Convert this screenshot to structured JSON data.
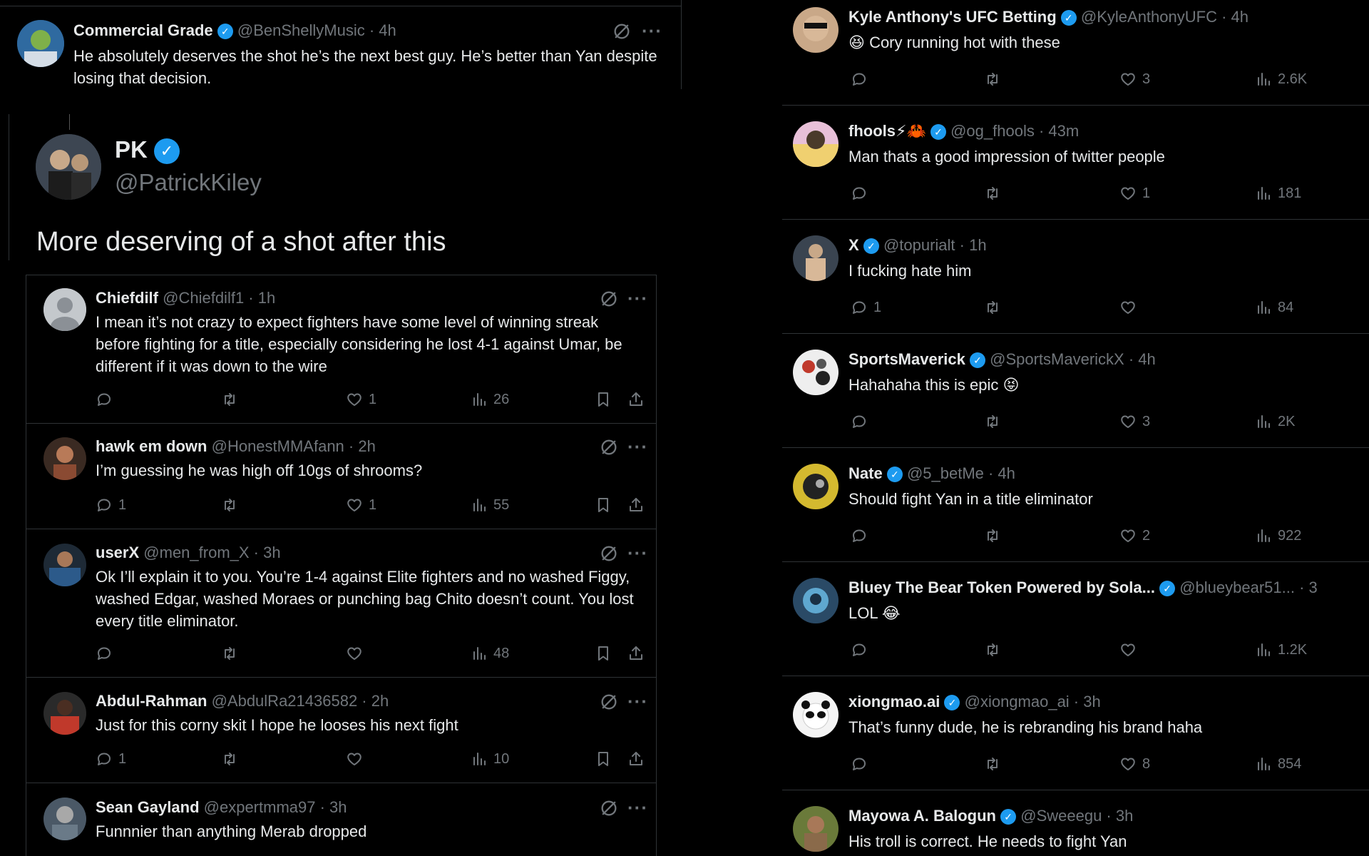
{
  "top_tweet": {
    "name": "Commercial Grade",
    "meta": "@BenShellyMusic · 4h",
    "text": "He absolutely deserves the shot he’s the next best guy. He’s better than Yan despite losing that decision."
  },
  "quoted": {
    "name": "PK",
    "handle": "@PatrickKiley",
    "text": "More deserving of a shot after this"
  },
  "left_replies": [
    {
      "name": "Chiefdilf",
      "meta": "@Chiefdilf1 · 1h",
      "text": "I mean it’s not crazy to expect fighters have some level of winning streak before fighting for a title, especially considering he lost 4-1 against Umar, be different if it was down to the wire",
      "replies": "",
      "likes": "1",
      "views": "26",
      "avatar": "#7b8186"
    },
    {
      "name": "hawk em down",
      "meta": "@HonestMMAfann · 2h",
      "text": "I’m guessing he was high off 10gs of shrooms?",
      "replies": "1",
      "likes": "1",
      "views": "55",
      "avatar": "#6b3a2a"
    },
    {
      "name": "userX",
      "meta": "@men_from_X · 3h",
      "text": "Ok I’ll explain it to you. You’re 1-4 against Elite fighters and no washed Figgy, washed Edgar, washed Moraes or punching bag Chito doesn’t count. You lost every title eliminator.",
      "replies": "",
      "likes": "",
      "views": "48",
      "avatar": "#2c5a8a"
    },
    {
      "name": "Abdul-Rahman",
      "meta": "@AbdulRa21436582 · 2h",
      "text": "Just for this corny skit I hope he looses his next fight",
      "replies": "1",
      "likes": "",
      "views": "10",
      "avatar": "#c0392b"
    },
    {
      "name": "Sean Gayland",
      "meta": "@expertmma97 · 3h",
      "text": "Funnnier than anything Merab dropped",
      "avatar": "#5a6b7a"
    }
  ],
  "right_replies": [
    {
      "name": "Kyle Anthony's UFC Betting",
      "meta": "@KyleAnthonyUFC · 4h",
      "text": "Cory running hot with these",
      "emoji": "😆",
      "replies": "",
      "likes": "3",
      "views": "2.6K",
      "avatar": "#b08a6a"
    },
    {
      "name": "fhools",
      "name_emoji": "⚡🦀",
      "meta": "@og_fhools · 43m",
      "text": "Man thats a good impression of twitter people",
      "replies": "",
      "likes": "1",
      "views": "181",
      "avatar": "#c7a0d8"
    },
    {
      "name": "X",
      "meta": "@topurialt · 1h",
      "text": "I fucking hate him",
      "replies": "1",
      "likes": "",
      "views": "84",
      "avatar": "#5d6d7a"
    },
    {
      "name": "SportsMaverick",
      "meta": "@SportsMaverickX · 4h",
      "text": "Hahahaha this is epic",
      "emoji": "😝",
      "replies": "",
      "likes": "3",
      "views": "2K",
      "avatar": "#e8e8e8"
    },
    {
      "name": "Nate",
      "meta": "@5_betMe · 4h",
      "text": "Should fight Yan in a title eliminator",
      "replies": "",
      "likes": "2",
      "views": "922",
      "avatar": "#d4b92f"
    },
    {
      "name": "Bluey The Bear Token Powered by Sola...",
      "meta": "@blueybear51... · 3",
      "text": "LOL",
      "emoji": "😂",
      "replies": "",
      "likes": "",
      "views": "1.2K",
      "avatar": "#3a7a9a"
    },
    {
      "name": "xiongmao.ai",
      "meta": "@xiongmao_ai · 3h",
      "text": "That’s funny dude, he is rebranding his brand haha",
      "replies": "",
      "likes": "8",
      "views": "854",
      "avatar": "#f0f0f0"
    },
    {
      "name": "Mayowa A. Balogun",
      "meta": "@Sweeegu · 3h",
      "text": "His troll is correct. He needs to fight Yan",
      "avatar": "#7a8a4a"
    }
  ],
  "icons": {
    "reply": "reply-icon",
    "retweet": "retweet-icon",
    "like": "heart-icon",
    "views": "analytics-icon",
    "bookmark": "bookmark-icon",
    "share": "share-icon",
    "grok": "grok-icon",
    "more": "more-icon",
    "verified": "verified-badge-icon"
  },
  "colors": {
    "background": "#000000",
    "text": "#e7e9ea",
    "muted": "#71767b",
    "verified": "#1d9bf0",
    "divider": "#2f3336"
  }
}
